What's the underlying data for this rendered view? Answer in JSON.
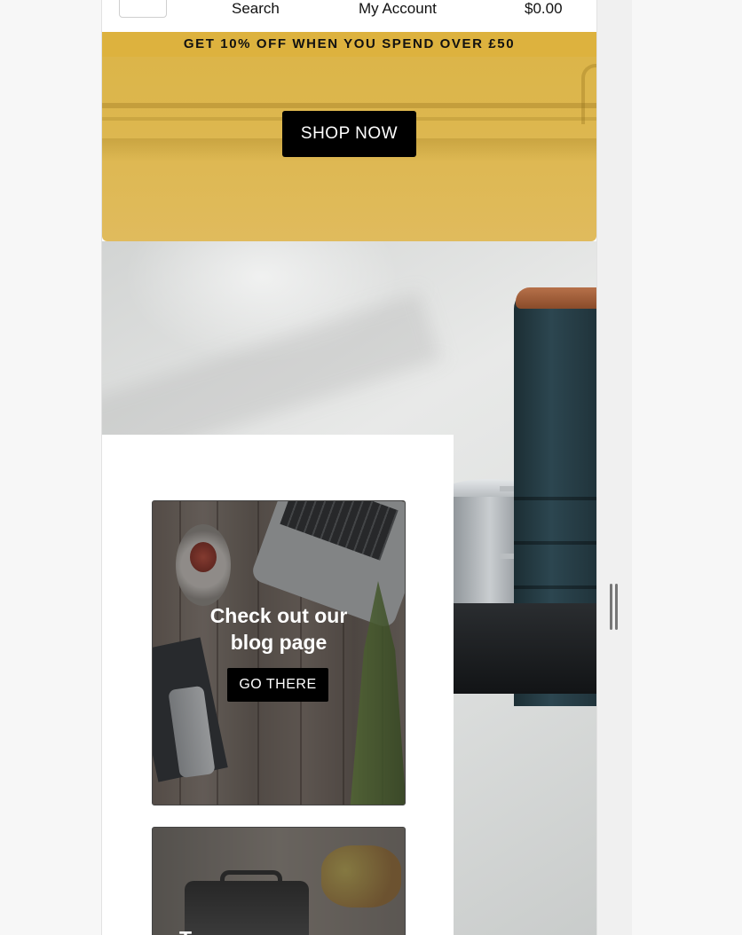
{
  "header": {
    "menu_icon": "hamburger-menu-icon",
    "search_label": "Search",
    "account_label": "My Account",
    "cart_total": "$0.00"
  },
  "promo_banner": {
    "text": "GET 10% OFF WHEN YOU SPEND OVER £50"
  },
  "hero": {
    "cta_label": "SHOP NOW",
    "accent_color": "#ddb23e"
  },
  "blog_card": {
    "title_line1": "Check out our",
    "title_line2": "blog page",
    "cta_label": "GO THERE"
  },
  "second_card": {
    "title_partial": "T"
  }
}
